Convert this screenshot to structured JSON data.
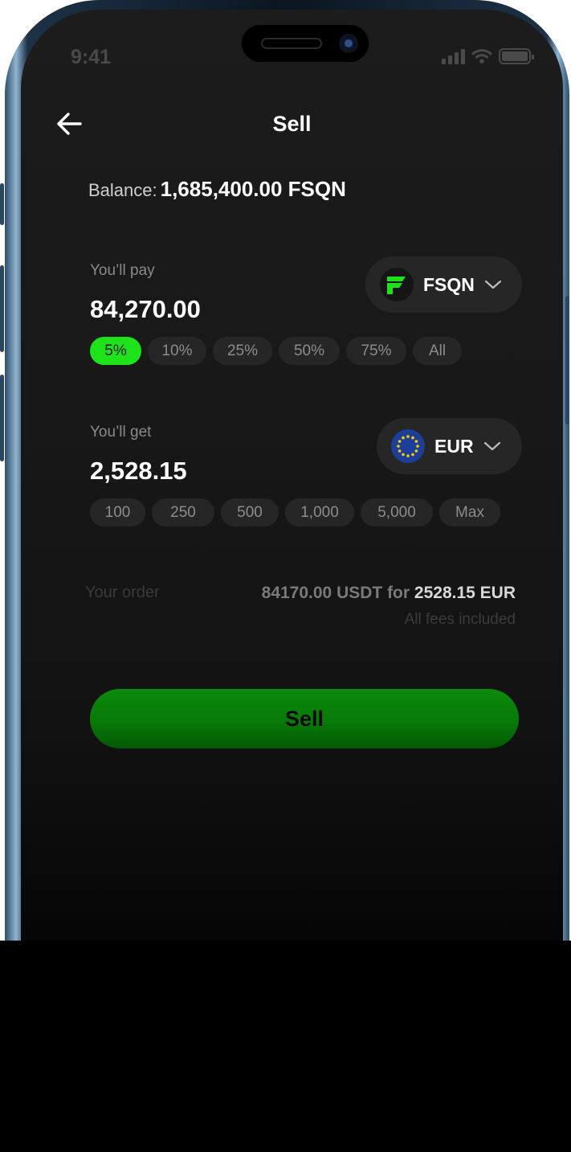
{
  "status_bar": {
    "time": "9:41"
  },
  "header": {
    "title": "Sell"
  },
  "balance": {
    "label": "Balance:",
    "value": "1,685,400.00 FSQN"
  },
  "pay": {
    "label": "You’ll pay",
    "amount": "84,270.00",
    "currency": "FSQN",
    "percent_chips": [
      "5%",
      "10%",
      "25%",
      "50%",
      "75%",
      "All"
    ],
    "selected_chip": "5%"
  },
  "get": {
    "label": "You’ll get",
    "amount": "2,528.15",
    "currency": "EUR",
    "amount_chips": [
      "100",
      "250",
      "500",
      "1,000",
      "5,000",
      "Max"
    ]
  },
  "order": {
    "label": "Your order",
    "pay_part": "84170.00 USDT for",
    "get_part": "2528.15 EUR",
    "fees_note": "All fees included"
  },
  "sell_button": {
    "label": "Sell"
  },
  "colors": {
    "accent_green": "#1ee31a",
    "button_green": "#0a8a0a",
    "background": "#1c1c1c"
  }
}
